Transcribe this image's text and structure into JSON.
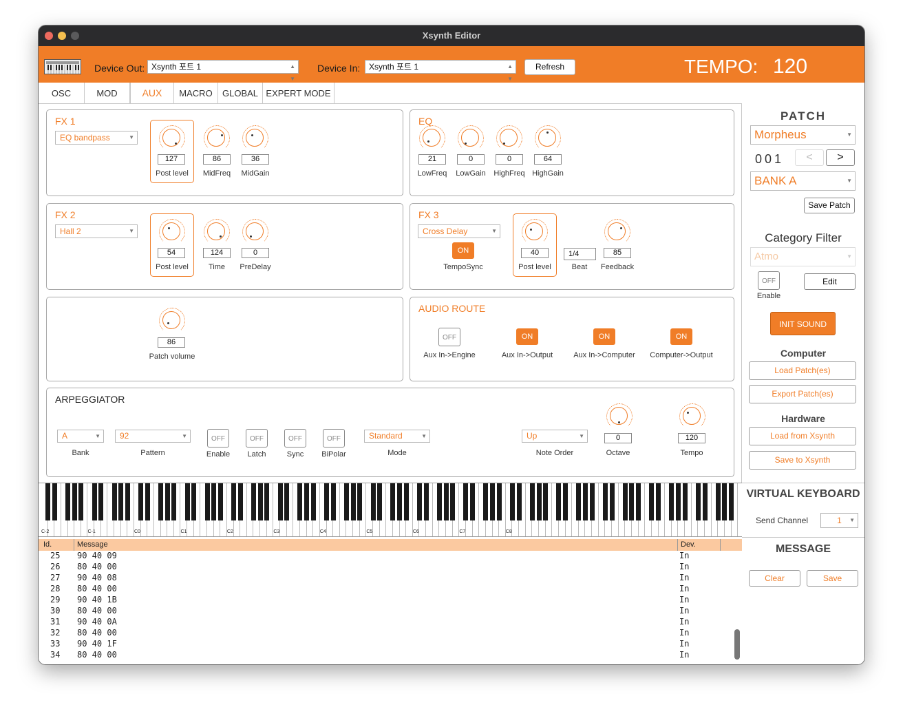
{
  "window": {
    "title": "Xsynth Editor"
  },
  "colors": {
    "accent": "#f07d27",
    "titlebar": "#2b2b2d",
    "close": "#ed6a5e",
    "minimize": "#f5bf4f",
    "zoom": "#5a5a5c"
  },
  "toolbar": {
    "device_out_label": "Device Out:",
    "device_out_value": "Xsynth 포트 1",
    "device_in_label": "Device In:",
    "device_in_value": "Xsynth 포트 1",
    "refresh_label": "Refresh",
    "tempo_label": "TEMPO:",
    "tempo_value": "120"
  },
  "tabs": [
    "OSC",
    "MOD",
    "AUX",
    "MACRO",
    "GLOBAL",
    "EXPERT MODE"
  ],
  "active_tab": "AUX",
  "fx1": {
    "title": "FX 1",
    "type": "EQ bandpass",
    "knobs": [
      {
        "value": "127",
        "label": "Post level"
      },
      {
        "value": "86",
        "label": "MidFreq"
      },
      {
        "value": "36",
        "label": "MidGain"
      }
    ]
  },
  "eq": {
    "title": "EQ",
    "knobs": [
      {
        "value": "21",
        "label": "LowFreq"
      },
      {
        "value": "0",
        "label": "LowGain"
      },
      {
        "value": "0",
        "label": "HighFreq"
      },
      {
        "value": "64",
        "label": "HighGain"
      }
    ]
  },
  "fx2": {
    "title": "FX 2",
    "type": "Hall 2",
    "knobs": [
      {
        "value": "54",
        "label": "Post level"
      },
      {
        "value": "124",
        "label": "Time"
      },
      {
        "value": "0",
        "label": "PreDelay"
      }
    ]
  },
  "fx3": {
    "title": "FX 3",
    "type": "Cross Delay",
    "temposync_state": "ON",
    "temposync_label": "TempoSync",
    "post_level": {
      "value": "40",
      "label": "Post level"
    },
    "beat": {
      "value": "1/4",
      "label": "Beat"
    },
    "feedback": {
      "value": "85",
      "label": "Feedback"
    }
  },
  "patch_volume": {
    "value": "86",
    "label": "Patch volume"
  },
  "audio_route": {
    "title": "AUDIO  ROUTE",
    "items": [
      {
        "state": "OFF",
        "label": "Aux In->Engine"
      },
      {
        "state": "ON",
        "label": "Aux In->Output"
      },
      {
        "state": "ON",
        "label": "Aux In->Computer"
      },
      {
        "state": "ON",
        "label": "Computer->Output"
      }
    ]
  },
  "arpeggiator": {
    "title": "ARPEGGIATOR",
    "bank": {
      "value": "A",
      "label": "Bank"
    },
    "pattern": {
      "value": "92",
      "label": "Pattern"
    },
    "toggles": [
      {
        "state": "OFF",
        "label": "Enable"
      },
      {
        "state": "OFF",
        "label": "Latch"
      },
      {
        "state": "OFF",
        "label": "Sync"
      },
      {
        "state": "OFF",
        "label": "BiPolar"
      }
    ],
    "mode": {
      "value": "Standard",
      "label": "Mode"
    },
    "note_order": {
      "value": "Up",
      "label": "Note Order"
    },
    "octave": {
      "value": "0",
      "label": "Octave"
    },
    "tempo": {
      "value": "120",
      "label": "Tempo"
    }
  },
  "patch": {
    "title": "PATCH",
    "name": "Morpheus",
    "number": "001",
    "prev": "<",
    "next": ">",
    "bank": "BANK A",
    "save_label": "Save Patch"
  },
  "category_filter": {
    "title": "Category Filter",
    "value": "Atmo",
    "enable_state": "OFF",
    "enable_label": "Enable",
    "edit_label": "Edit"
  },
  "init_sound": "INIT  SOUND",
  "computer": {
    "title": "Computer",
    "load": "Load Patch(es)",
    "export": "Export Patch(es)"
  },
  "hardware": {
    "title": "Hardware",
    "load": "Load from Xsynth",
    "save": "Save to Xsynth"
  },
  "virtual_keyboard": {
    "title": "VIRTUAL KEYBOARD",
    "send_channel_label": "Send Channel",
    "send_channel_value": "1"
  },
  "keyboard": {
    "octave_labels": [
      "C-2",
      "C-1",
      "C0",
      "C1",
      "C2",
      "C3",
      "C4",
      "C5",
      "C6",
      "C7",
      "C8"
    ]
  },
  "message": {
    "title": "MESSAGE",
    "clear_label": "Clear",
    "save_label": "Save",
    "columns": [
      "Id.",
      "Message",
      "Dev."
    ],
    "rows": [
      {
        "id": "25",
        "msg": "90 40 09",
        "dev": "In"
      },
      {
        "id": "26",
        "msg": "80 40 00",
        "dev": "In"
      },
      {
        "id": "27",
        "msg": "90 40 08",
        "dev": "In"
      },
      {
        "id": "28",
        "msg": "80 40 00",
        "dev": "In"
      },
      {
        "id": "29",
        "msg": "90 40 1B",
        "dev": "In"
      },
      {
        "id": "30",
        "msg": "80 40 00",
        "dev": "In"
      },
      {
        "id": "31",
        "msg": "90 40 0A",
        "dev": "In"
      },
      {
        "id": "32",
        "msg": "80 40 00",
        "dev": "In"
      },
      {
        "id": "33",
        "msg": "90 40 1F",
        "dev": "In"
      },
      {
        "id": "34",
        "msg": "80 40 00",
        "dev": "In"
      }
    ]
  }
}
